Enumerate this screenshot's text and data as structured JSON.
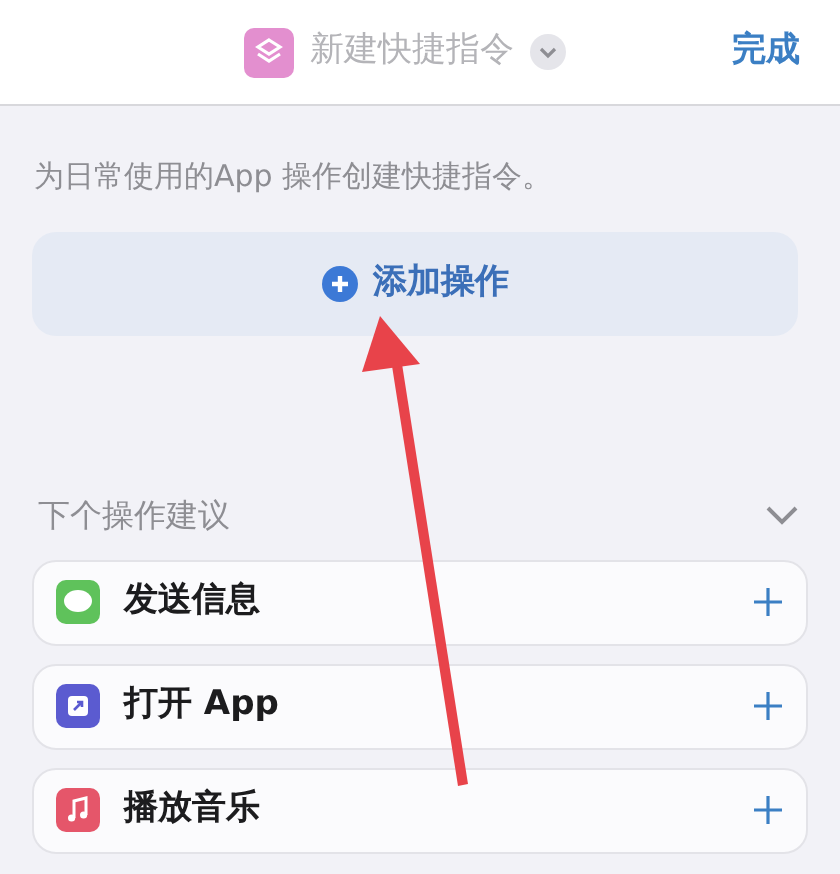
{
  "header": {
    "title": "新建快捷指令",
    "done": "完成"
  },
  "description": "为日常使用的App 操作创建快捷指令。",
  "add_action": "添加操作",
  "suggestions": {
    "title": "下个操作建议",
    "expanded": true,
    "items": [
      {
        "kind": "messages",
        "label": "发送信息"
      },
      {
        "kind": "open-app",
        "label": "打开 App"
      },
      {
        "kind": "music",
        "label": "播放音乐"
      }
    ]
  }
}
